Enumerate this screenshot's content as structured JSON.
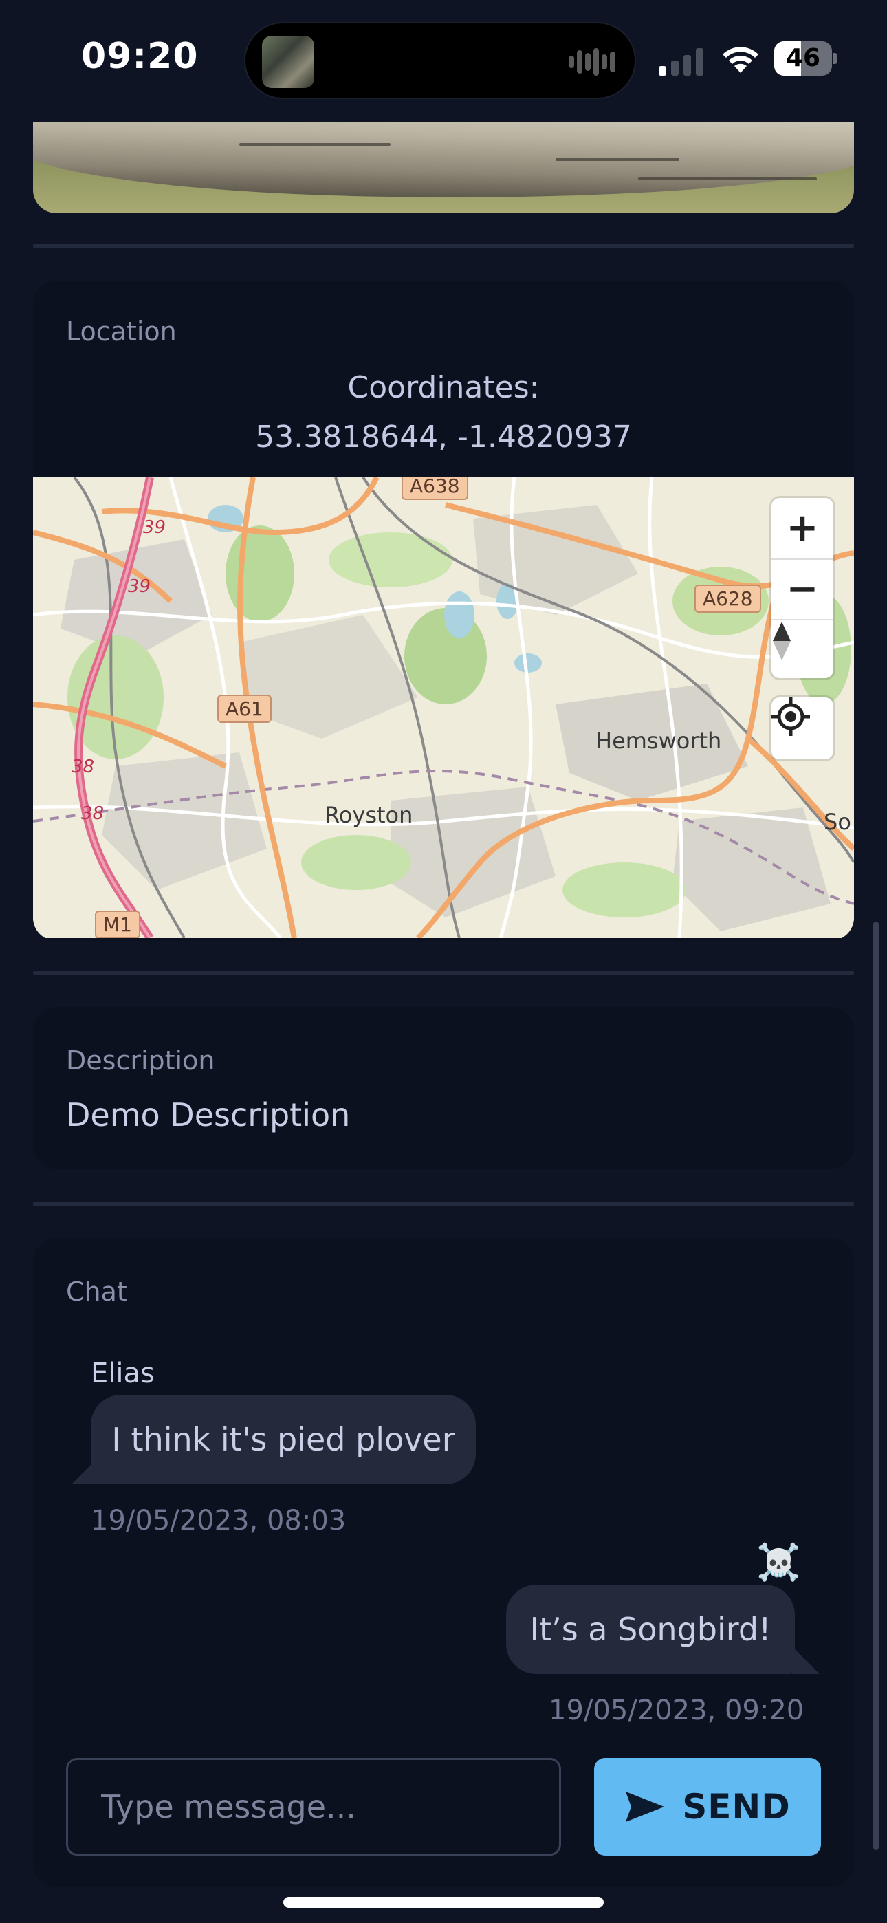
{
  "status_bar": {
    "time": "09:20",
    "battery": "46",
    "battery_level": 0.46,
    "signal_bars_active": 1
  },
  "location": {
    "label": "Location",
    "coordinates_title": "Coordinates:",
    "coordinates_value": "53.3818644, -1.4820937"
  },
  "map": {
    "places": [
      "Royston",
      "Hemsworth",
      "So"
    ],
    "roads": [
      "A638",
      "A628",
      "A61",
      "M1"
    ],
    "motorway_junctions": [
      "39",
      "39",
      "38",
      "38"
    ],
    "zoom_in": "+",
    "zoom_out": "−"
  },
  "description": {
    "label": "Description",
    "text": "Demo Description"
  },
  "chat": {
    "label": "Chat",
    "messages": [
      {
        "sender": "Elias",
        "text": "I think it's pied plover",
        "time": "19/05/2023, 08:03"
      },
      {
        "avatar": "☠️",
        "text": "It’s a Songbird!",
        "time": "19/05/2023, 09:20"
      }
    ],
    "input_placeholder": "Type message...",
    "send_label": "SEND"
  },
  "colors": {
    "background": "#0f1424",
    "card": "#0c1120",
    "bubble": "#242a3c",
    "send_button": "#62baf3"
  }
}
